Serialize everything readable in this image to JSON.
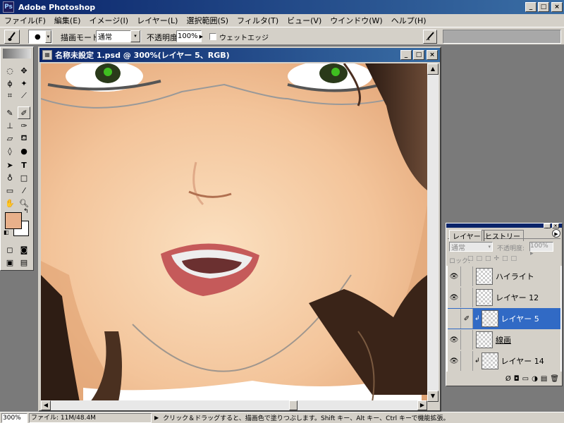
{
  "app": {
    "title": "Adobe Photoshop",
    "minimize": "_",
    "maximize": "□",
    "close": "×"
  },
  "menu": [
    "ファイル(F)",
    "編集(E)",
    "イメージ(I)",
    "レイヤー(L)",
    "選択範囲(S)",
    "フィルタ(T)",
    "ビュー(V)",
    "ウインドウ(W)",
    "ヘルプ(H)"
  ],
  "options": {
    "blend_label": "描画モード:",
    "blend_value": "通常",
    "opacity_label": "不透明度:",
    "opacity_value": "100%",
    "wet_edges_label": "ウェットエッジ"
  },
  "document": {
    "title": "名称未設定 1.psd @ 300%(レイヤー 5、RGB)"
  },
  "layers_panel": {
    "tab_layers": "レイヤー",
    "tab_history": "ヒストリー",
    "blend_value": "通常",
    "opacity_label": "不透明度:",
    "opacity_value": "100%",
    "lock_label": "ロック:",
    "layers": [
      {
        "name": "ハイライト",
        "visible": true,
        "selected": false,
        "clipped": false
      },
      {
        "name": "レイヤー 12",
        "visible": true,
        "selected": false,
        "clipped": false
      },
      {
        "name": "レイヤー 5",
        "visible": false,
        "selected": true,
        "clipped": true
      },
      {
        "name": "線画",
        "visible": true,
        "selected": false,
        "clipped": false
      },
      {
        "name": "レイヤー 14",
        "visible": true,
        "selected": false,
        "clipped": true
      }
    ]
  },
  "status": {
    "zoom": "300%",
    "file_info": "ファイル: 11M/48.4M",
    "hint": "クリック＆ドラッグすると、描画色で塗りつぶします。Shift キー、Alt キー、Ctrl キーで機能拡張。"
  },
  "colors": {
    "foreground": "#e8b08a",
    "background": "#ffffff",
    "selection": "#316ac5",
    "titlebar": "#0a246a"
  }
}
